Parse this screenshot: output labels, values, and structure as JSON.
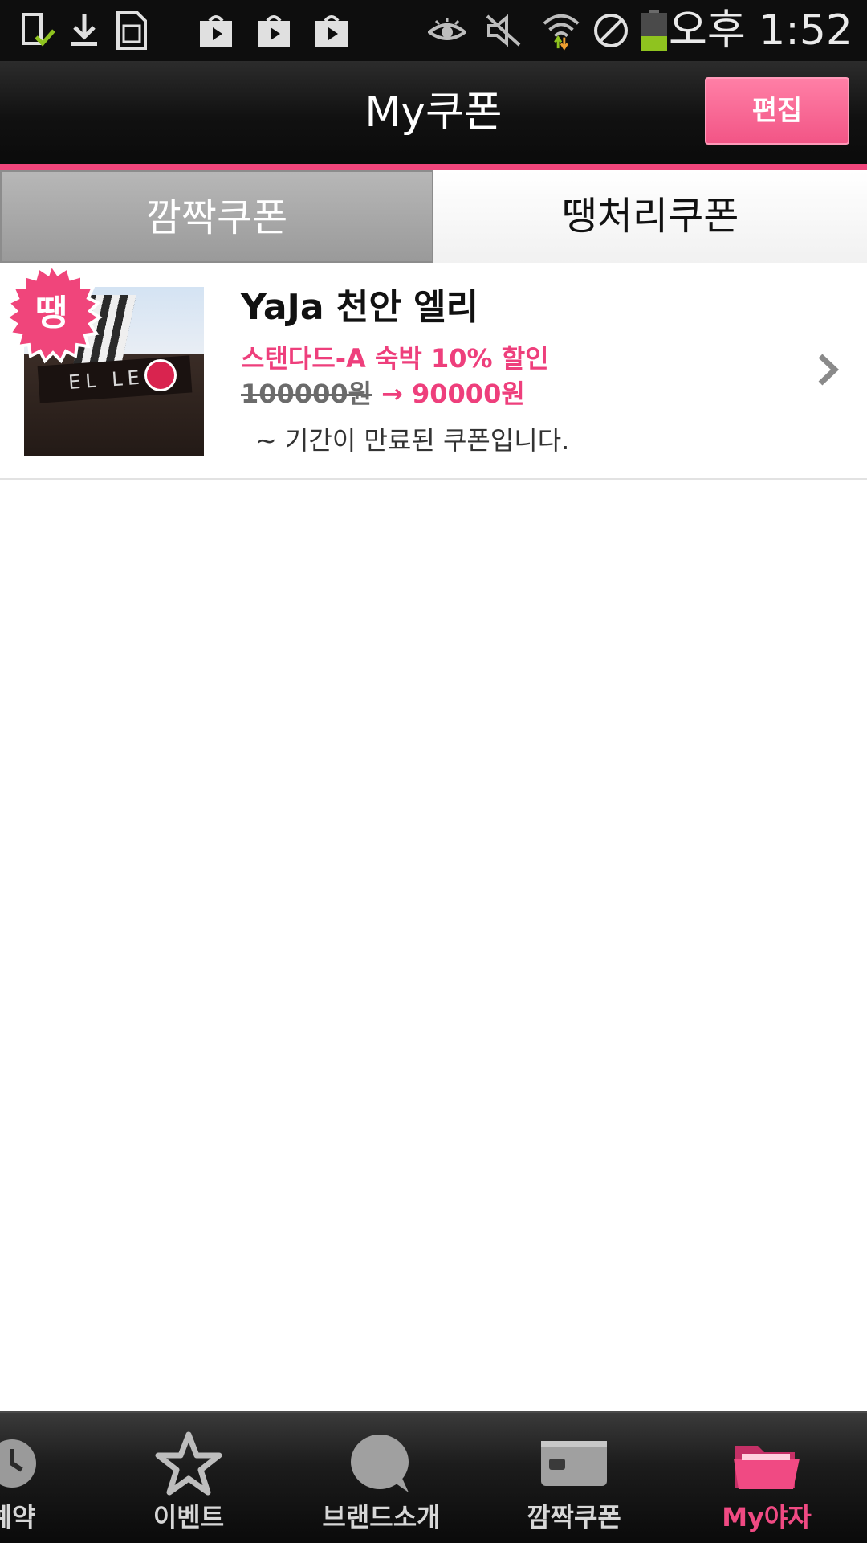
{
  "status_bar": {
    "time": "오후 1:52",
    "icons": [
      "phone-check-icon",
      "download-icon",
      "sim-card-icon",
      "shopping-bag-icon",
      "shopping-bag-icon",
      "shopping-bag-icon",
      "eye-icon",
      "mute-icon",
      "wifi-icon",
      "blocked-icon",
      "battery-icon"
    ]
  },
  "header": {
    "title": "My쿠폰",
    "edit_label": "편집"
  },
  "tabs": [
    {
      "label": "깜짝쿠폰",
      "selected": false
    },
    {
      "label": "땡처리쿠폰",
      "selected": true
    }
  ],
  "coupons": [
    {
      "badge": "땡",
      "name": "YaJa 천안 엘리",
      "description": "스탠다드-A 숙박 10% 할인",
      "original_price": "100000원",
      "discounted_price": "→ 90000원",
      "status": "~ 기간이 만료된 쿠폰입니다."
    }
  ],
  "bottom_nav": [
    {
      "label": "예약",
      "icon": "clock-icon",
      "active": false
    },
    {
      "label": "이벤트",
      "icon": "star-icon",
      "active": false
    },
    {
      "label": "브랜드소개",
      "icon": "speech-bubble-icon",
      "active": false
    },
    {
      "label": "깜짝쿠폰",
      "icon": "card-icon",
      "active": false
    },
    {
      "label": "My야자",
      "icon": "folder-icon",
      "active": true
    }
  ],
  "colors": {
    "accent": "#f0457b",
    "status_bar": "#0e0e0e",
    "active_nav": "#f04a83"
  }
}
